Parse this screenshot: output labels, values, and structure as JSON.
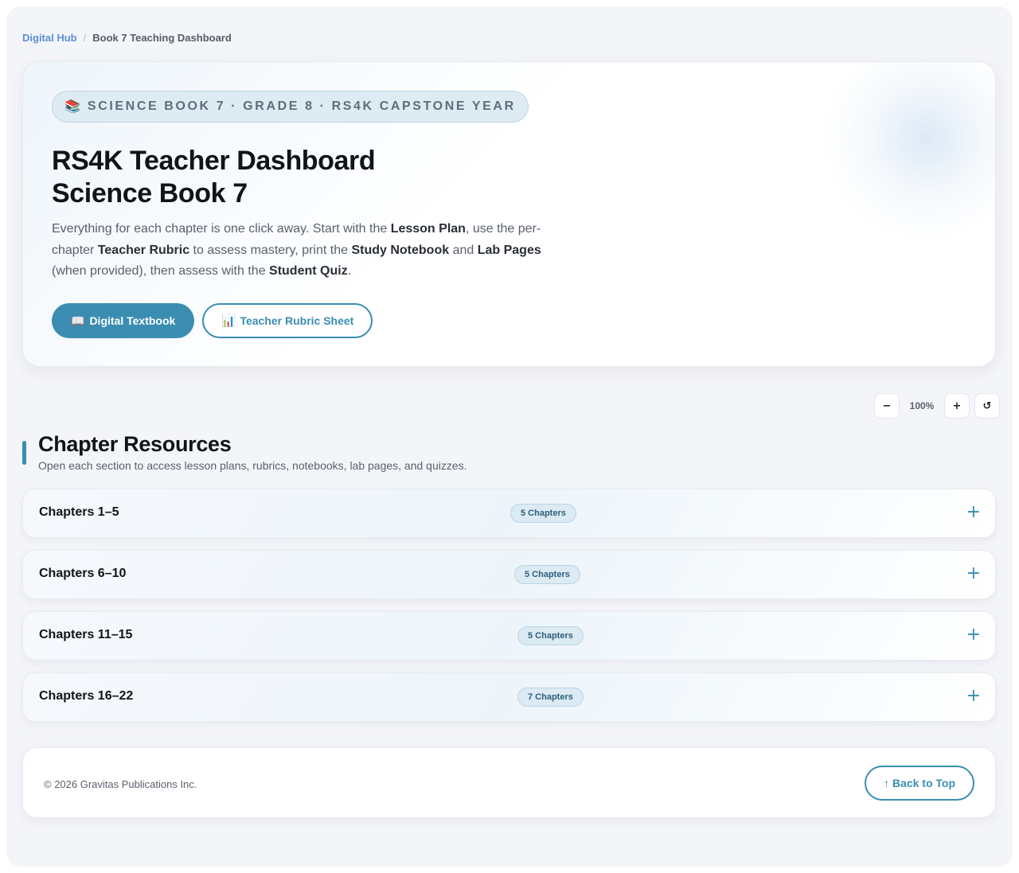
{
  "breadcrumb": {
    "home": "Digital Hub",
    "separator": "/",
    "current": "Book 7 Teaching Dashboard"
  },
  "hero": {
    "badge_icon": "📚",
    "badge_text": "SCIENCE BOOK 7 · GRADE 8 · RS4K CAPSTONE YEAR",
    "title_line1": "RS4K Teacher Dashboard",
    "title_line2": "Science Book 7",
    "description": {
      "t1": "Everything for each chapter is one click away. Start with the ",
      "b1": "Lesson Plan",
      "t2": ", use the per-chapter ",
      "b2": "Teacher Rubric",
      "t3": " to assess mastery, print the ",
      "b3": "Study Notebook",
      "t4": " and ",
      "b4": "Lab Pages",
      "t5": " (when provided), then assess with the ",
      "b5": "Student Quiz",
      "t6": "."
    },
    "primary_button": {
      "icon": "📖",
      "label": "Digital Textbook"
    },
    "secondary_button": {
      "icon": "📊",
      "label": "Teacher Rubric Sheet"
    }
  },
  "zoom": {
    "decrease": "−",
    "level": "100%",
    "increase": "+",
    "reset": "↺"
  },
  "section": {
    "title": "Chapter Resources",
    "subtitle": "Open each section to access lesson plans, rubrics, notebooks, lab pages, and quizzes."
  },
  "accordions": [
    {
      "title": "Chapters 1–5",
      "badge": "5 Chapters",
      "toggle": "+"
    },
    {
      "title": "Chapters 6–10",
      "badge": "5 Chapters",
      "toggle": "+"
    },
    {
      "title": "Chapters 11–15",
      "badge": "5 Chapters",
      "toggle": "+"
    },
    {
      "title": "Chapters 16–22",
      "badge": "7 Chapters",
      "toggle": "+"
    }
  ],
  "footer": {
    "copyright": "© 2026 Gravitas Publications Inc.",
    "back_to_top": "↑ Back to Top"
  },
  "colors": {
    "accent": "#3a8db1",
    "link": "#5b8fd9",
    "badge_bg": "#dbeaf3"
  },
  "icons": {
    "badge": "books-icon",
    "primary_button": "open-book-icon",
    "secondary_button": "bar-chart-icon",
    "zoom_reset": "reset-icon",
    "accordion_toggle": "plus-icon"
  }
}
